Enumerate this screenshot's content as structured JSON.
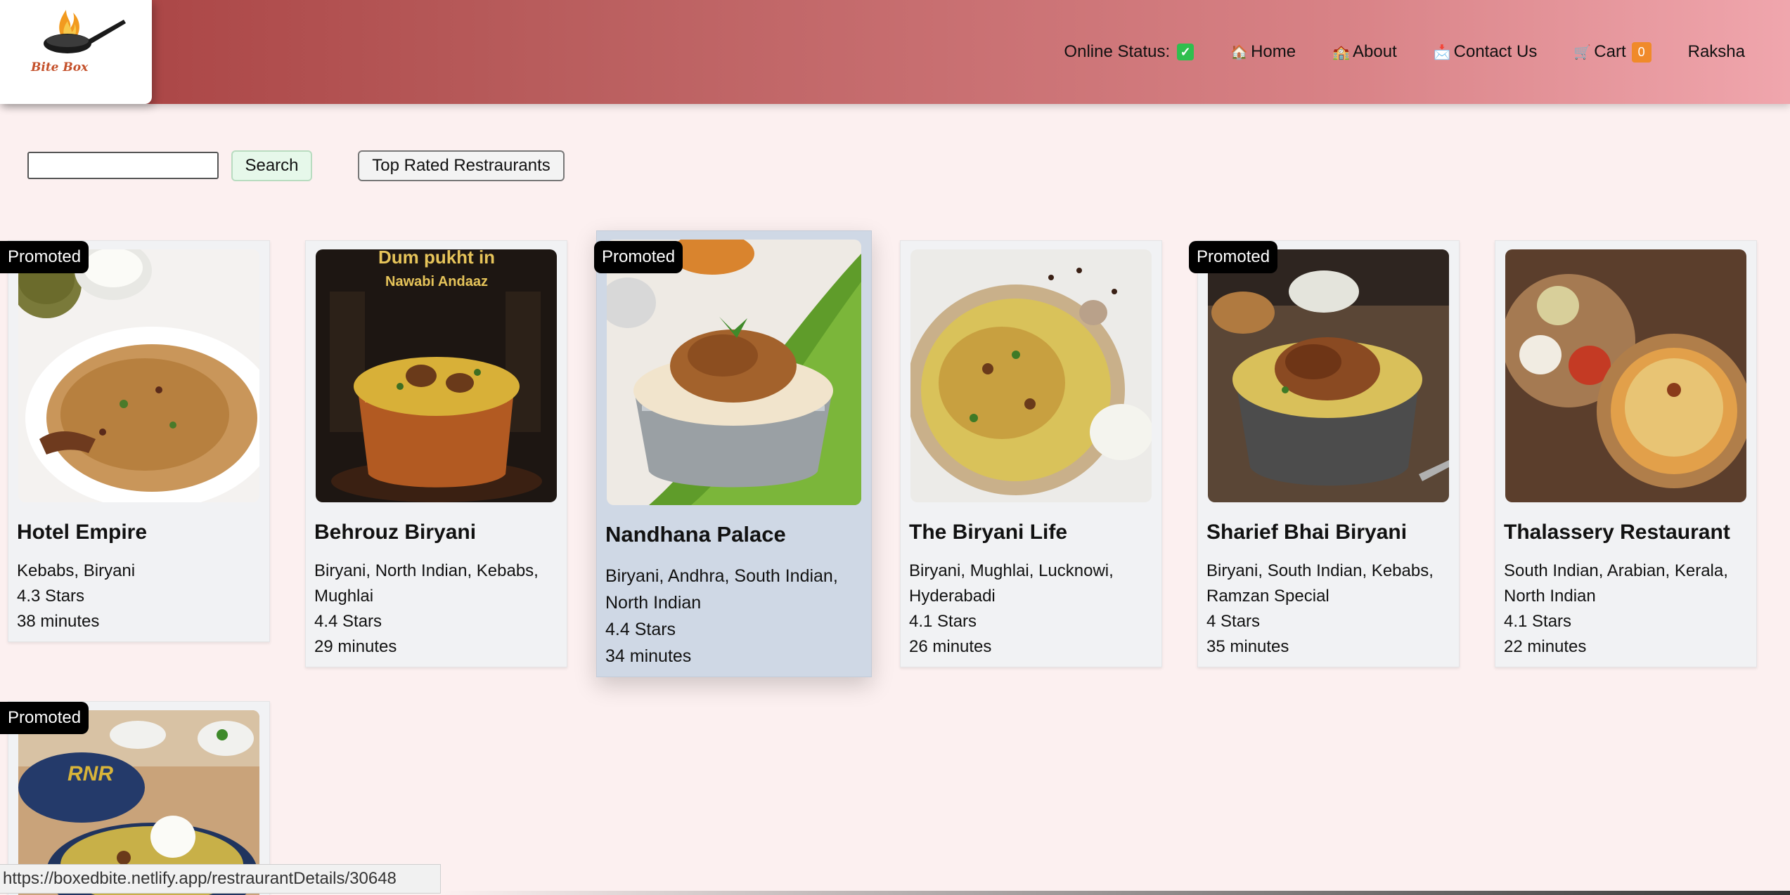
{
  "logo": {
    "text": "Bite Box",
    "icon": "pan-flame-icon"
  },
  "nav": {
    "online_status_label": "Online Status:",
    "online_status_icon": "✓",
    "home_emoji": "🏠",
    "home": "Home",
    "about_emoji": "🏫",
    "about": "About",
    "contact_emoji": "📩",
    "contact": "Contact Us",
    "cart_emoji": "🛒",
    "cart": "Cart",
    "cart_count": "0",
    "user": "Raksha"
  },
  "search": {
    "value": "",
    "button": "Search"
  },
  "filter": {
    "top_rated": "Top Rated Restraurants"
  },
  "promoted_label": "Promoted",
  "restaurants": [
    {
      "name": "Hotel Empire",
      "cuisines": "Kebabs, Biryani",
      "rating": "4.3 Stars",
      "time": "38 minutes",
      "promoted": true
    },
    {
      "name": "Behrouz Biryani",
      "cuisines": "Biryani, North Indian, Kebabs, Mughlai",
      "rating": "4.4 Stars",
      "time": "29 minutes",
      "promoted": false,
      "image_text_1": "Dum pukht in",
      "image_text_2": "Nawabi Andaaz"
    },
    {
      "name": "Nandhana Palace",
      "cuisines": "Biryani, Andhra, South Indian, North Indian",
      "rating": "4.4 Stars",
      "time": "34 minutes",
      "promoted": true
    },
    {
      "name": "The Biryani Life",
      "cuisines": "Biryani, Mughlai, Lucknowi, Hyderabadi",
      "rating": "4.1 Stars",
      "time": "26 minutes",
      "promoted": false
    },
    {
      "name": "Sharief Bhai Biryani",
      "cuisines": "Biryani, South Indian, Kebabs, Ramzan Special",
      "rating": "4 Stars",
      "time": "35 minutes",
      "promoted": true
    },
    {
      "name": "Thalassery Restaurant",
      "cuisines": "South Indian, Arabian, Kerala, North Indian",
      "rating": "4.1 Stars",
      "time": "22 minutes",
      "promoted": false
    },
    {
      "promoted": true,
      "image_text": "RNR"
    }
  ],
  "status_bar": {
    "url": "https://boxedbite.netlify.app/restraurantDetails/30648"
  },
  "colors": {
    "header_start": "#a73f3f",
    "header_end": "#f0a6ad",
    "page_bg": "#fcf0f0",
    "card_bg": "#f1f2f4",
    "card_hover": "#cfd8e5",
    "cart_badge": "#f08a2a",
    "online_check": "#2fbf4e"
  }
}
